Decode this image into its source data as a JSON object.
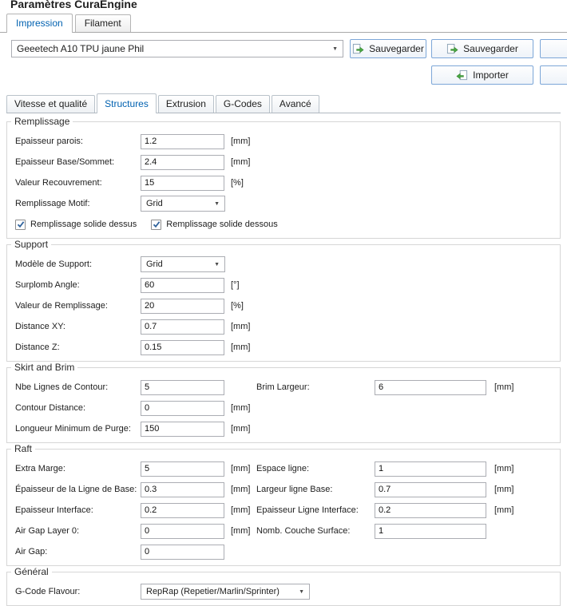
{
  "title": "Paramètres CuraEngine",
  "tabs_top": {
    "impression": "Impression",
    "filament": "Filament"
  },
  "profile_bar": {
    "dropdown_value": "Geeetech A10 TPU jaune Phil",
    "save1_label": "Sauvegarder",
    "save2_label": "Sauvegarder",
    "import_label": "Importer"
  },
  "tabs_inner": {
    "t0": "Vitesse et qualité",
    "t1": "Structures",
    "t2": "Extrusion",
    "t3": "G-Codes",
    "t4": "Avancé"
  },
  "remplissage": {
    "title": "Remplissage",
    "rows": [
      {
        "label": "Epaisseur parois:",
        "value": "1.2",
        "unit": "[mm]"
      },
      {
        "label": "Epaisseur Base/Sommet:",
        "value": "2.4",
        "unit": "[mm]"
      },
      {
        "label": "Valeur Recouvrement:",
        "value": "15",
        "unit": "[%]"
      }
    ],
    "motif_label": "Remplissage Motif:",
    "motif_value": "Grid",
    "check_top_label": "Remplissage solide dessus",
    "check_top_checked": true,
    "check_bottom_label": "Remplissage solide dessous",
    "check_bottom_checked": true
  },
  "support": {
    "title": "Support",
    "model_label": "Modèle de Support:",
    "model_value": "Grid",
    "rows": [
      {
        "label": "Surplomb Angle:",
        "value": "60",
        "unit": "[°]"
      },
      {
        "label": "Valeur de Remplissage:",
        "value": "20",
        "unit": "[%]"
      },
      {
        "label": "Distance XY:",
        "value": "0.7",
        "unit": "[mm]"
      },
      {
        "label": "Distance Z:",
        "value": "0.15",
        "unit": "[mm]"
      }
    ]
  },
  "skirt": {
    "title": "Skirt and Brim",
    "rows": [
      {
        "label": "Nbe Lignes de Contour:",
        "value": "5",
        "unit": "",
        "label2": "Brim Largeur:",
        "value2": "6",
        "unit2": "[mm]"
      },
      {
        "label": "Contour Distance:",
        "value": "0",
        "unit": "[mm]"
      },
      {
        "label": "Longueur Minimum de Purge:",
        "value": "150",
        "unit": "[mm]"
      }
    ]
  },
  "raft": {
    "title": "Raft",
    "rows": [
      {
        "label": "Extra Marge:",
        "value": "5",
        "unit": "[mm]",
        "label2": "Espace ligne:",
        "value2": "1",
        "unit2": "[mm]"
      },
      {
        "label": "Épaisseur de la Ligne de Base:",
        "value": "0.3",
        "unit": "[mm]",
        "label2": "Largeur ligne Base:",
        "value2": "0.7",
        "unit2": "[mm]"
      },
      {
        "label": "Epaisseur Interface:",
        "value": "0.2",
        "unit": "[mm]",
        "label2": "Epaisseur Ligne Interface:",
        "value2": "0.2",
        "unit2": "[mm]"
      },
      {
        "label": "Air Gap Layer 0:",
        "value": "0",
        "unit": "[mm]",
        "label2": "Nomb. Couche Surface:",
        "value2": "1",
        "unit2": ""
      },
      {
        "label": "Air Gap:",
        "value": "0",
        "unit": ""
      }
    ]
  },
  "general": {
    "title": "Général",
    "flavour_label": "G-Code Flavour:",
    "flavour_value": "RepRap (Repetier/Marlin/Sprinter)"
  }
}
